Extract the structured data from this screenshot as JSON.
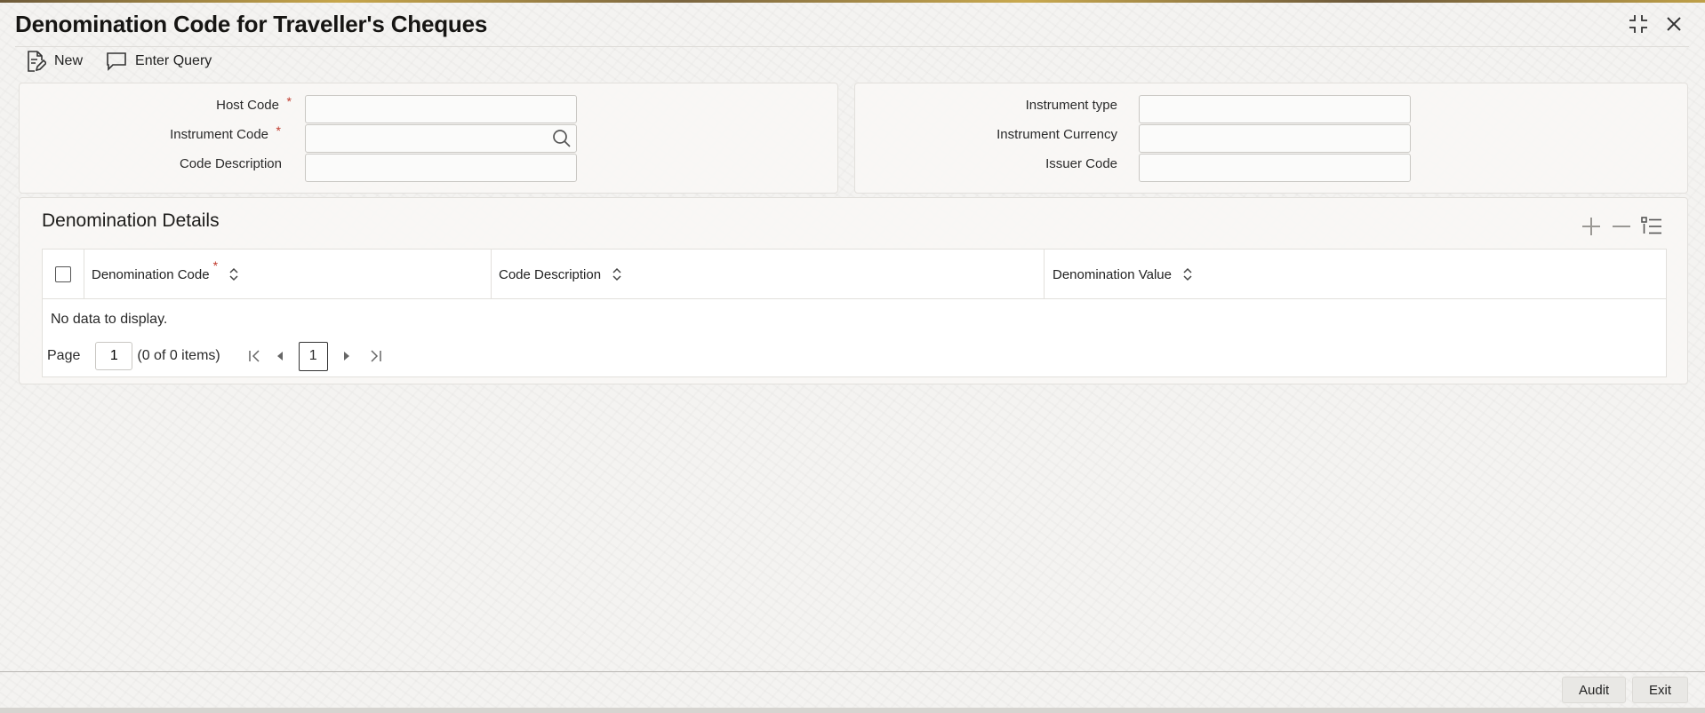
{
  "window": {
    "title": "Denomination Code for Traveller's Cheques",
    "controls": [
      {
        "name": "collapse-icon"
      },
      {
        "name": "close-icon"
      }
    ]
  },
  "toolbar": {
    "new_label": "New",
    "enter_query_label": "Enter Query"
  },
  "header_form": {
    "host_code": {
      "label": "Host Code",
      "value": "",
      "required": "*"
    },
    "instrument_code": {
      "label": "Instrument Code",
      "value": "",
      "required": "*"
    },
    "code_description": {
      "label": "Code Description",
      "value": ""
    },
    "instrument_type": {
      "label": "Instrument type",
      "value": ""
    },
    "instrument_currency": {
      "label": "Instrument Currency",
      "value": ""
    },
    "issuer_code": {
      "label": "Issuer Code",
      "value": ""
    }
  },
  "details": {
    "title": "Denomination Details",
    "columns": [
      {
        "label": "Denomination Code",
        "required": "*"
      },
      {
        "label": "Code Description"
      },
      {
        "label": "Denomination Value"
      }
    ],
    "rows": [],
    "empty_text": "No data to display.",
    "pager": {
      "page_label": "Page",
      "page_value": "1",
      "items_text": "(0 of 0 items)",
      "current_page": "1"
    }
  },
  "footer": {
    "audit_label": "Audit",
    "exit_label": "Exit"
  },
  "colors": {
    "accent_required": "#c0392b",
    "panel_bg": "#f8f7f5",
    "border": "#e2e0dc"
  }
}
